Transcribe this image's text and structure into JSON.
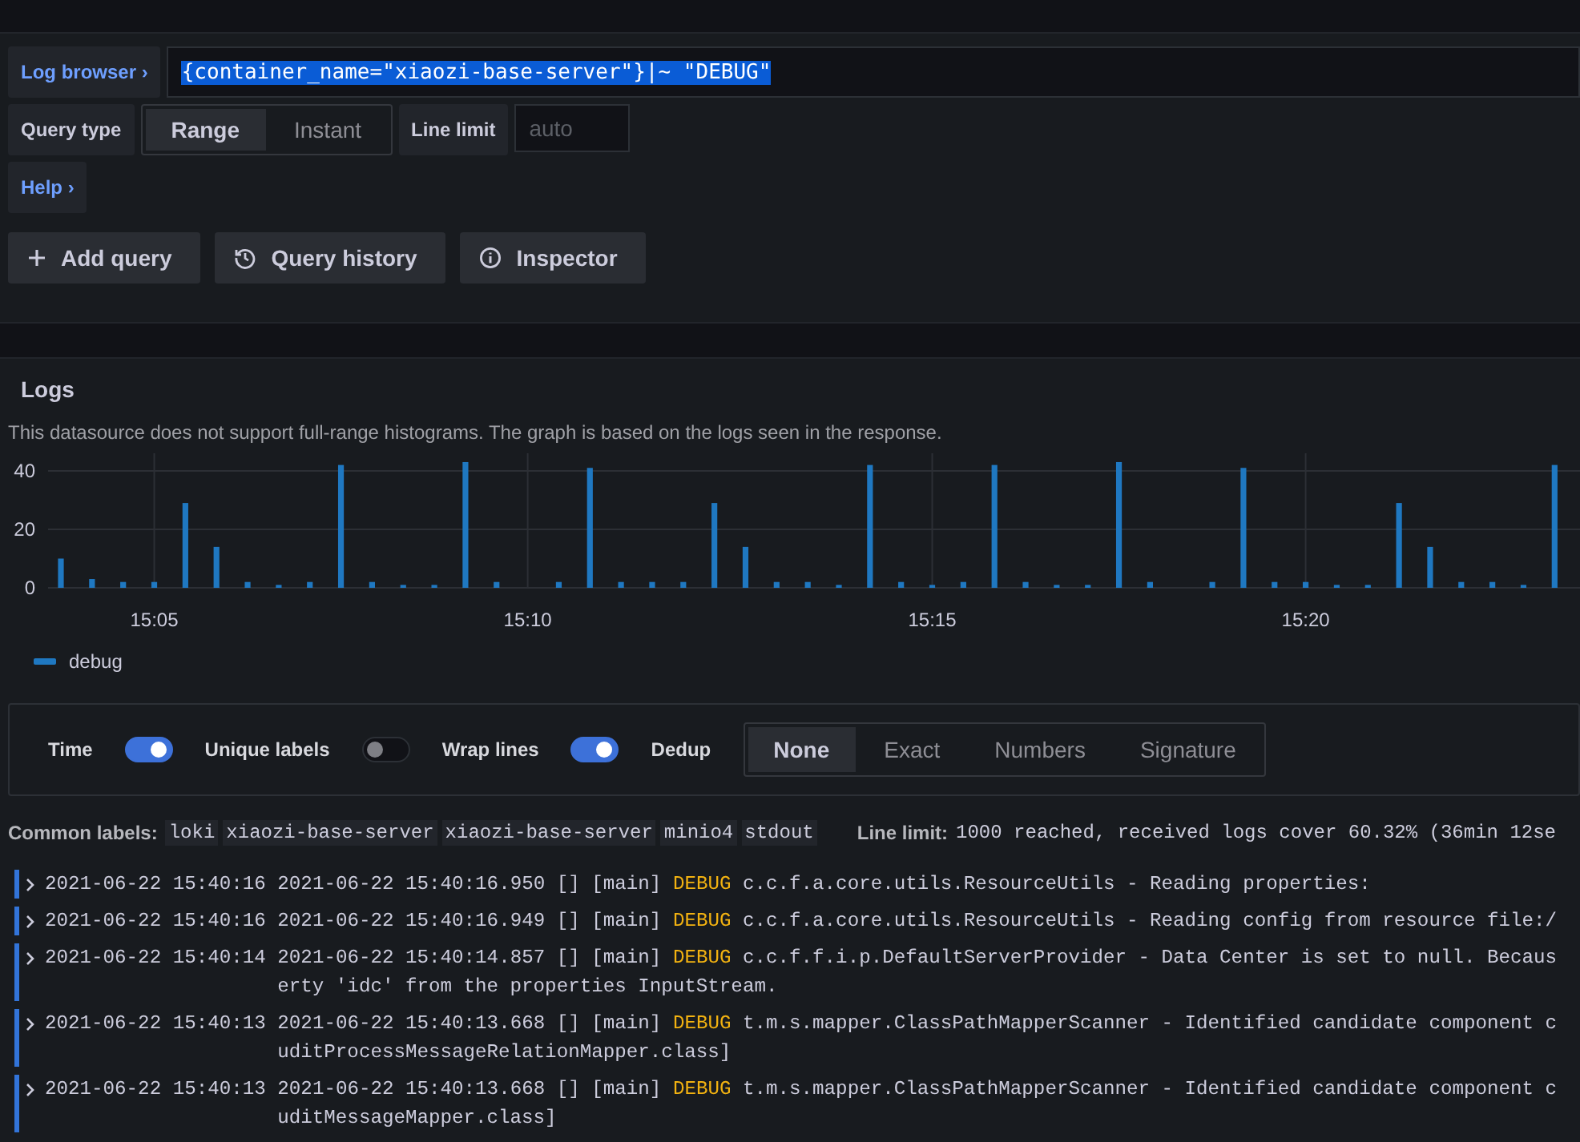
{
  "query_editor": {
    "log_browser_button": "Log browser",
    "chevron": "›",
    "query": "{container_name=\"xiaozi-base-server\"}|~ \"DEBUG\"",
    "query_selected": true,
    "query_type_label": "Query type",
    "query_types": [
      {
        "label": "Range",
        "selected": true
      },
      {
        "label": "Instant",
        "selected": false
      }
    ],
    "line_limit_label": "Line limit",
    "line_limit_placeholder": "auto",
    "help_button": "Help"
  },
  "actions": [
    {
      "label": "Add query"
    },
    {
      "label": "Query history"
    },
    {
      "label": "Inspector"
    }
  ],
  "logs_panel": {
    "title": "Logs",
    "notice": "This datasource does not support full-range histograms. The graph is based on the logs seen in the response.",
    "chart_data": {
      "type": "bar",
      "categories": [
        null,
        null,
        null,
        "15:05",
        null,
        null,
        null,
        null,
        null,
        null,
        null,
        null,
        null,
        null,
        null,
        "15:10",
        null,
        null,
        null,
        null,
        null,
        null,
        null,
        null,
        null,
        null,
        null,
        null,
        "15:15",
        null,
        null,
        null,
        null,
        null,
        null,
        null,
        null,
        null,
        null,
        null,
        "15:20",
        null,
        null,
        null,
        null,
        null,
        null,
        null,
        null
      ],
      "series": [
        {
          "name": "debug",
          "color": "#1f78c1",
          "values": [
            10,
            3,
            2,
            2,
            29,
            14,
            2,
            1,
            2,
            42,
            2,
            1,
            1,
            43,
            2,
            0,
            2,
            41,
            2,
            2,
            2,
            29,
            14,
            2,
            2,
            1,
            42,
            2,
            1,
            2,
            42,
            2,
            1,
            1,
            43,
            2,
            0,
            2,
            41,
            2,
            2,
            1,
            1,
            29,
            14,
            2,
            2,
            1,
            42
          ]
        }
      ],
      "ylim": [
        0,
        46
      ],
      "grid": true,
      "yticks": [
        0,
        20,
        40
      ]
    },
    "options": [
      {
        "label": "Time",
        "on": true
      },
      {
        "label": "Unique labels",
        "on": false
      },
      {
        "label": "Wrap lines",
        "on": true
      }
    ],
    "dedup_label": "Dedup",
    "dedup_options": [
      {
        "label": "None",
        "selected": true
      },
      {
        "label": "Exact",
        "selected": false
      },
      {
        "label": "Numbers",
        "selected": false
      },
      {
        "label": "Signature",
        "selected": false
      }
    ],
    "common_labels_title": "Common labels:",
    "common_labels": [
      "loki",
      "xiaozi-base-server",
      "xiaozi-base-server",
      "minio4",
      "stdout"
    ],
    "line_limit_title": "Line limit:",
    "line_limit_text": "1000 reached, received logs cover 60.32% (36min 12se",
    "rows": [
      {
        "time": "2021-06-22 15:40:16",
        "prefix": "2021-06-22 15:40:16.950 [] [main]",
        "level": "DEBUG",
        "message": "c.c.f.a.core.utils.ResourceUtils - Reading properties:"
      },
      {
        "time": "2021-06-22 15:40:16",
        "prefix": "2021-06-22 15:40:16.949 [] [main]",
        "level": "DEBUG",
        "message": "c.c.f.a.core.utils.ResourceUtils - Reading config from resource file:/"
      },
      {
        "time": "2021-06-22 15:40:14",
        "prefix": "2021-06-22 15:40:14.857 [] [main]",
        "level": "DEBUG",
        "message": "c.c.f.f.i.p.DefaultServerProvider - Data Center is set to null. Becaus",
        "continuation": "erty 'idc' from the properties InputStream."
      },
      {
        "time": "2021-06-22 15:40:13",
        "prefix": "2021-06-22 15:40:13.668 [] [main]",
        "level": "DEBUG",
        "message": "t.m.s.mapper.ClassPathMapperScanner - Identified candidate component c",
        "continuation": "uditProcessMessageRelationMapper.class]"
      },
      {
        "time": "2021-06-22 15:40:13",
        "prefix": "2021-06-22 15:40:13.668 [] [main]",
        "level": "DEBUG",
        "message": "t.m.s.mapper.ClassPathMapperScanner - Identified candidate component c",
        "continuation": "uditMessageMapper.class]"
      }
    ]
  }
}
